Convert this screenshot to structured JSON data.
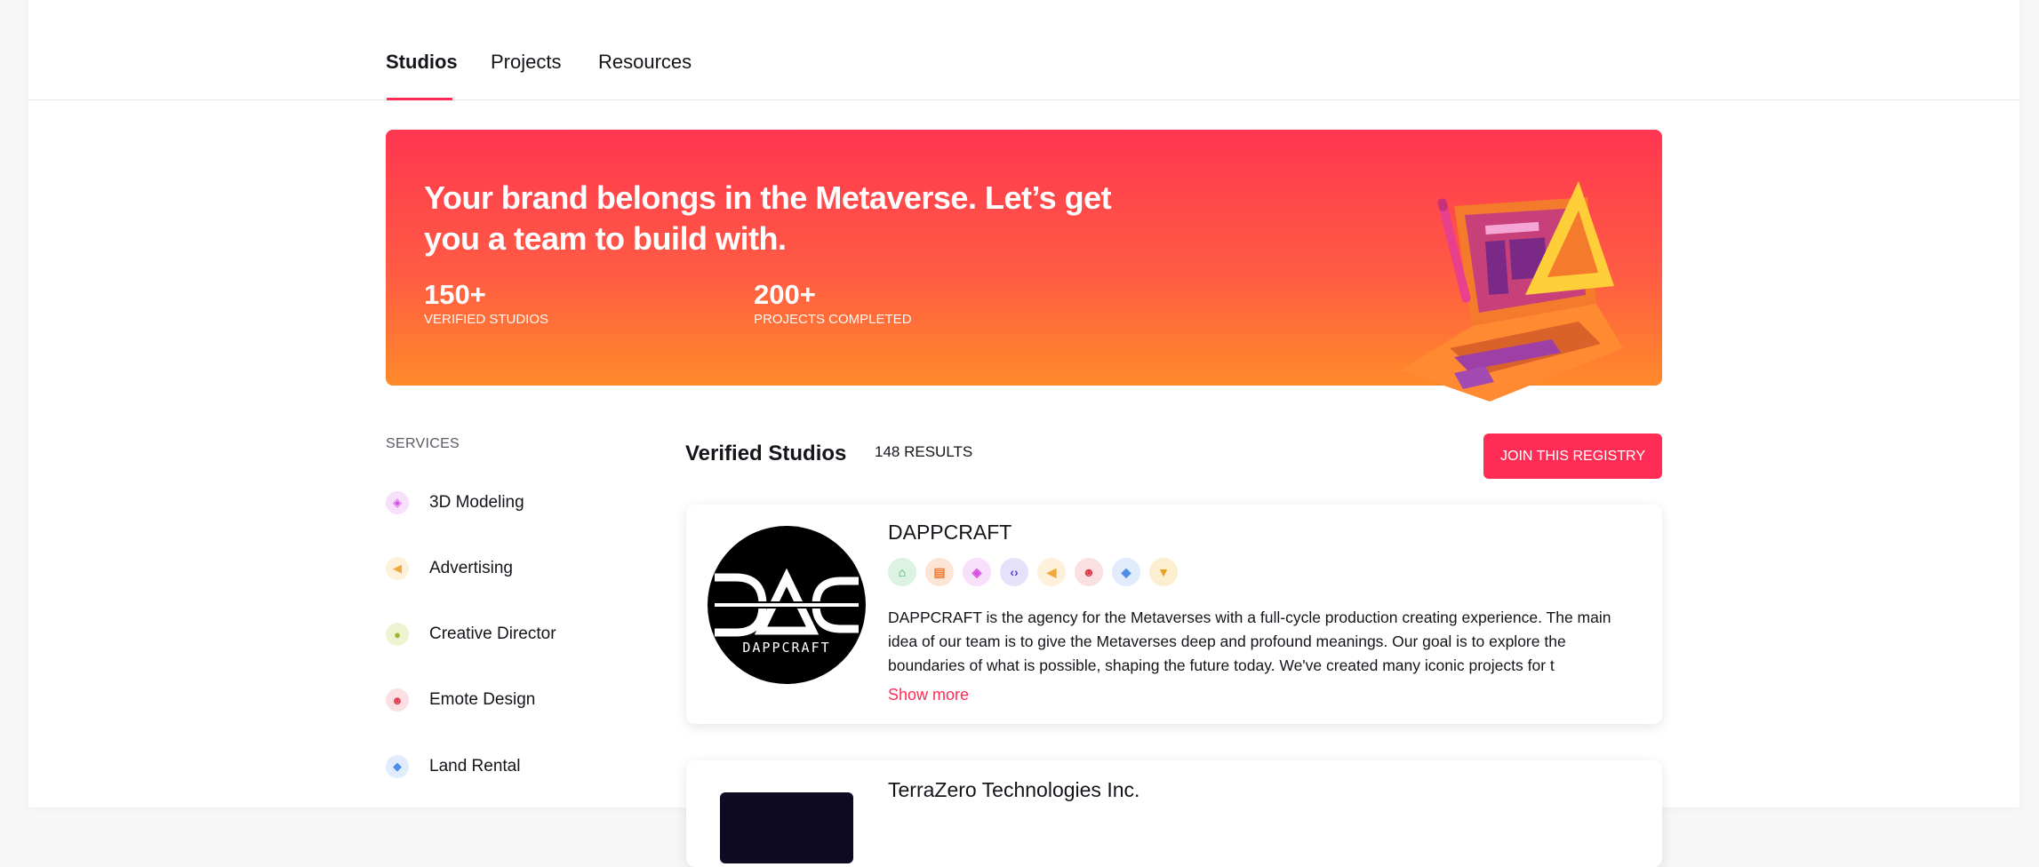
{
  "nav": {
    "tabs": [
      {
        "label": "Studios"
      },
      {
        "label": "Projects"
      },
      {
        "label": "Resources"
      }
    ]
  },
  "hero": {
    "title": "Your brand belongs in the Metaverse. Let’s get you a team to build with.",
    "stats": [
      {
        "value": "150+",
        "label": "VERIFIED STUDIOS"
      },
      {
        "value": "200+",
        "label": "PROJECTS COMPLETED"
      }
    ]
  },
  "sidebar": {
    "heading": "SERVICES",
    "items": [
      {
        "label": "3D Modeling",
        "icon": "cube-icon",
        "color": "#d64fe0",
        "bg": "#f6e0fa"
      },
      {
        "label": "Advertising",
        "icon": "megaphone-icon",
        "color": "#f2a93b",
        "bg": "#fdf1dc"
      },
      {
        "label": "Creative Director",
        "icon": "lightbulb-icon",
        "color": "#9fb62a",
        "bg": "#eef4d2"
      },
      {
        "label": "Emote Design",
        "icon": "smiley-icon",
        "color": "#e0394a",
        "bg": "#fbe0e3"
      },
      {
        "label": "Land Rental",
        "icon": "layers-icon",
        "color": "#4f8ee8",
        "bg": "#e0ecfb"
      }
    ]
  },
  "results": {
    "title": "Verified Studios",
    "count": "148 RESULTS",
    "join_label": "JOIN THIS REGISTRY"
  },
  "studios": [
    {
      "name": "DAPPCRAFT",
      "logo_text": "DAPPCRAFT",
      "description": "DAPPCRAFT is the agency for the Metaverses with a full-cycle production creating experience. The main idea of our team is to give the Metaverses deep and profound meanings. Our goal is to explore the boundaries of what is possible, shaping the future today. We've created many iconic projects for t",
      "show_more": "Show more",
      "badges": [
        {
          "icon": "hanger-icon",
          "glyph": "⌂",
          "color": "#3aa657",
          "bg": "#dcf2e2"
        },
        {
          "icon": "store-icon",
          "glyph": "▤",
          "color": "#f07a2f",
          "bg": "#fde5d6"
        },
        {
          "icon": "cube-icon",
          "glyph": "◈",
          "color": "#d64fe0",
          "bg": "#f6e0fa"
        },
        {
          "icon": "code-icon",
          "glyph": "‹›",
          "color": "#5a3fd9",
          "bg": "#e6e1fb"
        },
        {
          "icon": "megaphone-icon",
          "glyph": "◀",
          "color": "#f2a93b",
          "bg": "#fdf1dc"
        },
        {
          "icon": "smiley-icon",
          "glyph": "☻",
          "color": "#e0394a",
          "bg": "#fbe0e3"
        },
        {
          "icon": "layers-icon",
          "glyph": "◆",
          "color": "#4f8ee8",
          "bg": "#e0ecfb"
        },
        {
          "icon": "tshirt-icon",
          "glyph": "▼",
          "color": "#e8a21d",
          "bg": "#fcefcf"
        }
      ]
    },
    {
      "name": "TerraZero Technologies Inc."
    }
  ]
}
